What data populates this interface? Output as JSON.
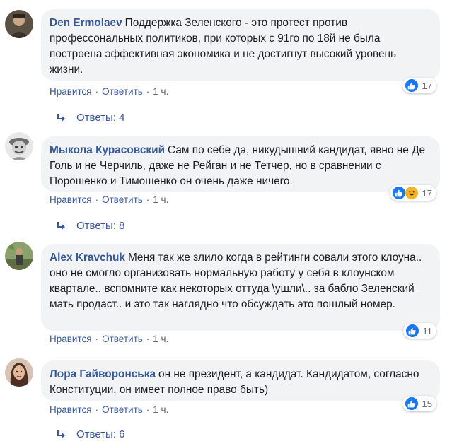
{
  "comments": [
    {
      "author": "Den Ermolaev",
      "text": "Поддержка Зеленского - это протест против профессональных политиков, при которых с 91го по 18й не была построена эффективная экономика и не достигнут высокий уровень жизни.",
      "reaction_count": "17",
      "reactions": [
        "like"
      ],
      "like_label": "Нравится",
      "reply_label": "Ответить",
      "time": "1 ч.",
      "replies_label": "Ответы: 4"
    },
    {
      "author": "Мыкола Курасовский",
      "text": "Сам по себе да, никудышний кандидат, явно не Де Голь и не Черчиль, даже не Рейган и не Тетчер, но в сравнении с Порошенко и Тимошенко он очень даже ничего.",
      "reaction_count": "17",
      "reactions": [
        "like",
        "haha"
      ],
      "like_label": "Нравится",
      "reply_label": "Ответить",
      "time": "1 ч.",
      "replies_label": "Ответы: 8"
    },
    {
      "author": "Alex Kravchuk",
      "text": "Меня так же злило когда в рейтинги совали этого клоуна.. оно не смогло организовать нормальную работу у себя в клоунском квартале.. вспомните как некоторых оттуда \\ушли\\.. за бабло Зеленский мать продаст.. и это так наглядно что обсуждать это пошлый номер.",
      "reaction_count": "11",
      "reactions": [
        "like"
      ],
      "like_label": "Нравится",
      "reply_label": "Ответить",
      "time": "1 ч."
    },
    {
      "author": "Лора Гайворонська",
      "text": "он не президент, а кандидат. Кандидатом, согласно Конституции, он имеет полное право быть)",
      "reaction_count": "15",
      "reactions": [
        "like"
      ],
      "like_label": "Нравится",
      "reply_label": "Ответить",
      "time": "1 ч.",
      "replies_label": "Ответы: 6"
    }
  ],
  "icons": {
    "like": "like-icon",
    "haha": "haha-icon",
    "reply_arrow": "reply-arrow-icon"
  },
  "colors": {
    "author_link": "#385898",
    "bubble_bg": "#f2f3f5",
    "like_blue": "#1877f2",
    "haha_yellow": "#f7b125",
    "meta_gray": "#606770"
  }
}
